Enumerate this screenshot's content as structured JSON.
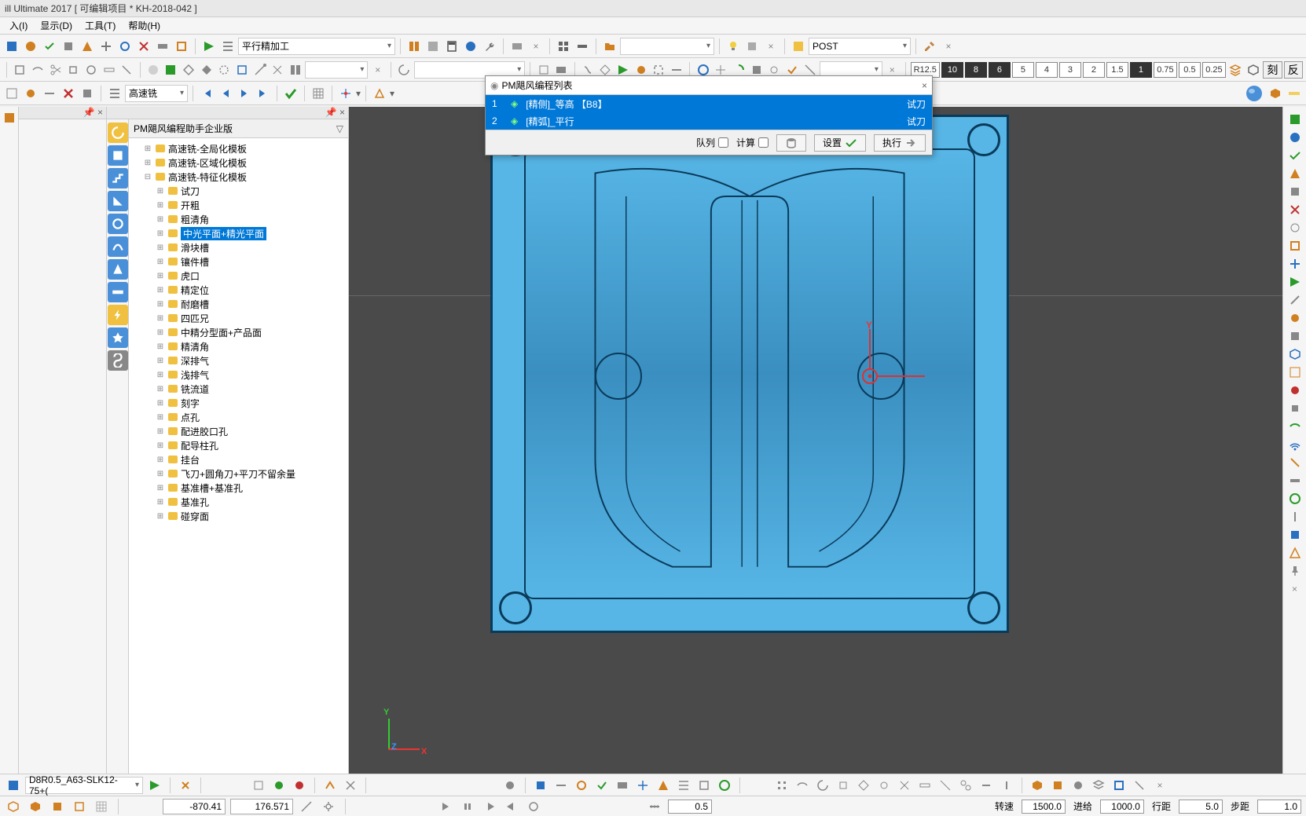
{
  "title": "ill Ultimate 2017    [ 可编辑项目 * KH-2018-042 ]",
  "menu": {
    "insert": "入(I)",
    "display": "显示(D)",
    "tools": "工具(T)",
    "help": "帮助(H)"
  },
  "toolbar1": {
    "combo1": "平行精加工",
    "post_label": "POST"
  },
  "toolbar2": {
    "r_label": "R12.5",
    "badges": [
      "10",
      "8",
      "6",
      "5",
      "4",
      "3",
      "2",
      "1.5",
      "1",
      "0.75",
      "0.5",
      "0.25"
    ],
    "char_btn1": "刻",
    "char_btn2": "反"
  },
  "toolbar3": {
    "combo": "高速铣"
  },
  "tree": {
    "header": "PM飓风编程助手企业版",
    "root1": "高速铣-全局化模板",
    "root2": "高速铣-区域化模板",
    "root3": "高速铣-特征化模板",
    "items": [
      "试刀",
      "开粗",
      "粗清角",
      "中光平面+精光平面",
      "滑块槽",
      "镶件槽",
      "虎口",
      "精定位",
      "耐磨槽",
      "四匹兄",
      "中精分型面+产品面",
      "精清角",
      "深排气",
      "浅排气",
      "铣流道",
      "刻字",
      "点孔",
      "配进胶口孔",
      "配导柱孔",
      "挂台",
      "飞刀+圆角刀+平刀不留余量",
      "基准槽+基准孔",
      "基准孔",
      "碰穿面"
    ],
    "selected_index": 3
  },
  "dialog": {
    "title": "PM飓风编程列表",
    "rows": [
      {
        "n": "1",
        "name": "[精侧]_等高  【B8】",
        "action": "试刀"
      },
      {
        "n": "2",
        "name": "[精弧]_平行",
        "action": "试刀"
      }
    ],
    "foot": {
      "queue": "队列",
      "calc": "计算",
      "settings": "设置",
      "execute": "执行"
    }
  },
  "axis": {
    "x": "X",
    "y": "Y",
    "z": "Z"
  },
  "bottom1": {
    "tool_combo": "D8R0.5_A63-SLK12-75+("
  },
  "status": {
    "x": "-870.41",
    "y": "176.571",
    "unit_val": "0.5",
    "speed_label": "转速",
    "speed_val": "1500.0",
    "feed_label": "进给",
    "feed_val": "1000.0",
    "travel_label": "行距",
    "travel_val": "5.0",
    "step_label": "步距",
    "step_val": "1.0"
  }
}
